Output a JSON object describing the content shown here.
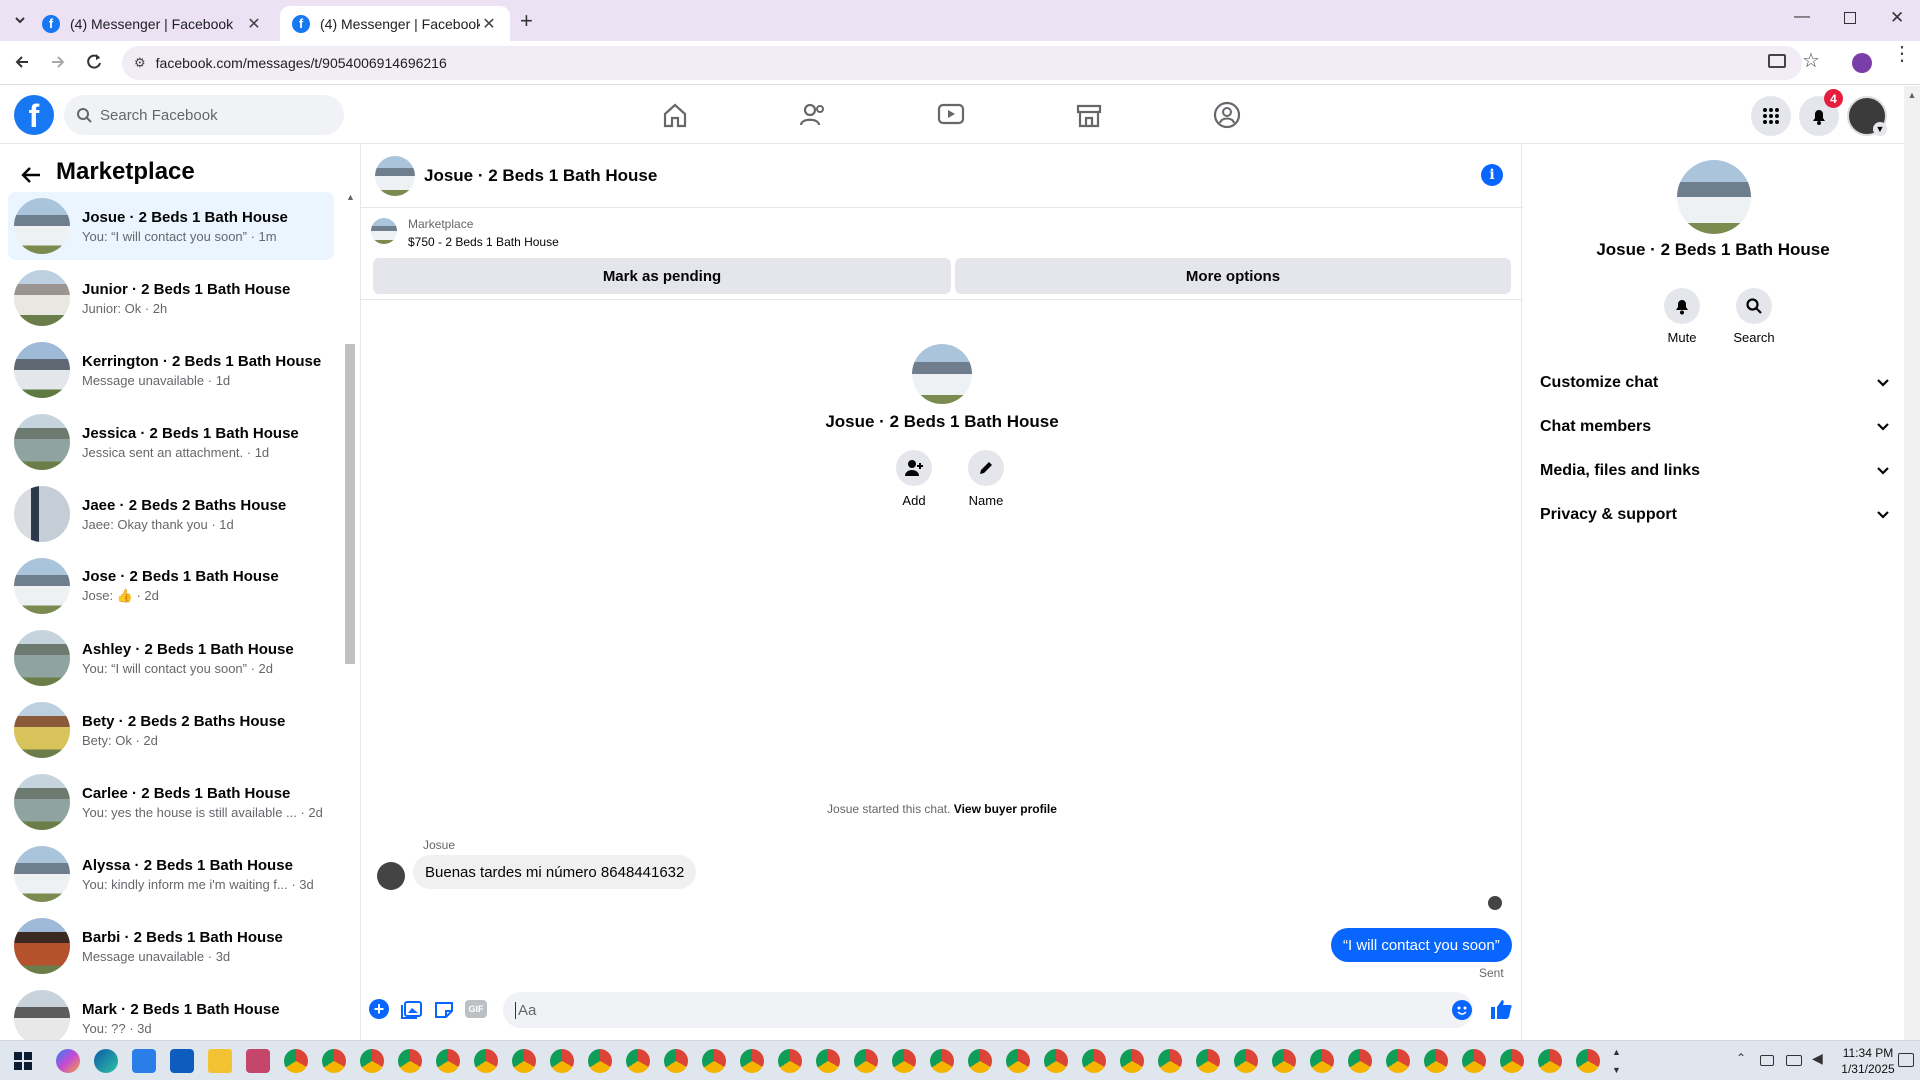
{
  "browser": {
    "tabs": [
      {
        "title": "(4) Messenger | Facebook",
        "active": false
      },
      {
        "title": "(4) Messenger | Facebook",
        "active": true
      }
    ],
    "url": "facebook.com/messages/t/9054006914696216"
  },
  "header": {
    "search_placeholder": "Search Facebook",
    "notification_count": "4",
    "nav_icons": [
      "home-icon",
      "friends-icon",
      "video-icon",
      "marketplace-icon",
      "groups-icon"
    ]
  },
  "sidebar": {
    "title": "Marketplace",
    "conversations": [
      {
        "name": "Josue · 2 Beds 1 Bath House",
        "preview": "You: “I will contact you soon” · 1m",
        "selected": true
      },
      {
        "name": "Junior · 2 Beds 1 Bath House",
        "preview": "Junior: Ok · 2h"
      },
      {
        "name": "Kerrington · 2 Beds 1 Bath House",
        "preview": "Message unavailable · 1d"
      },
      {
        "name": "Jessica · 2 Beds 1 Bath House",
        "preview": "Jessica sent an attachment. · 1d"
      },
      {
        "name": "Jaee · 2 Beds 2 Baths House",
        "preview": "Jaee: Okay thank you · 1d"
      },
      {
        "name": "Jose · 2 Beds 1 Bath House",
        "preview": "Jose: 👍 · 2d"
      },
      {
        "name": "Ashley · 2 Beds 1 Bath House",
        "preview": "You: “I will contact you soon” · 2d"
      },
      {
        "name": "Bety · 2 Beds 2 Baths House",
        "preview": "Bety: Ok · 2d"
      },
      {
        "name": "Carlee · 2 Beds 1 Bath House",
        "preview": "You: yes the house is still available ... · 2d"
      },
      {
        "name": "Alyssa · 2 Beds 1 Bath House",
        "preview": "You: kindly inform me i'm waiting f... · 3d"
      },
      {
        "name": "Barbi · 2 Beds 1 Bath House",
        "preview": "Message unavailable · 3d"
      },
      {
        "name": "Mark · 2 Beds 1 Bath House",
        "preview": "You: ?? · 3d"
      }
    ]
  },
  "chat": {
    "title": "Josue · 2 Beds 1 Bath House",
    "listing_source": "Marketplace",
    "listing": "$750 - 2 Beds 1 Bath House",
    "mark_pending": "Mark as pending",
    "more_options": "More options",
    "profile_name": "Josue · 2 Beds 1 Bath House",
    "add_label": "Add",
    "name_label": "Name",
    "started_text": "Josue started this chat.",
    "view_buyer": "View buyer profile",
    "sender_name": "Josue",
    "incoming_message": "Buenas tardes mi número 8648441632",
    "outgoing_message": "“I will contact you soon”",
    "sent_status": "Sent",
    "composer_placeholder": "Aa"
  },
  "info_panel": {
    "name": "Josue · 2 Beds 1 Bath House",
    "mute": "Mute",
    "search": "Search",
    "sections": [
      "Customize chat",
      "Chat members",
      "Media, files and links",
      "Privacy & support"
    ]
  },
  "taskbar": {
    "time": "11:34 PM",
    "date": "1/31/2025"
  },
  "colors": {
    "accent": "#0866ff",
    "brand": "#1877f2",
    "selected": "#ebf5ff"
  }
}
